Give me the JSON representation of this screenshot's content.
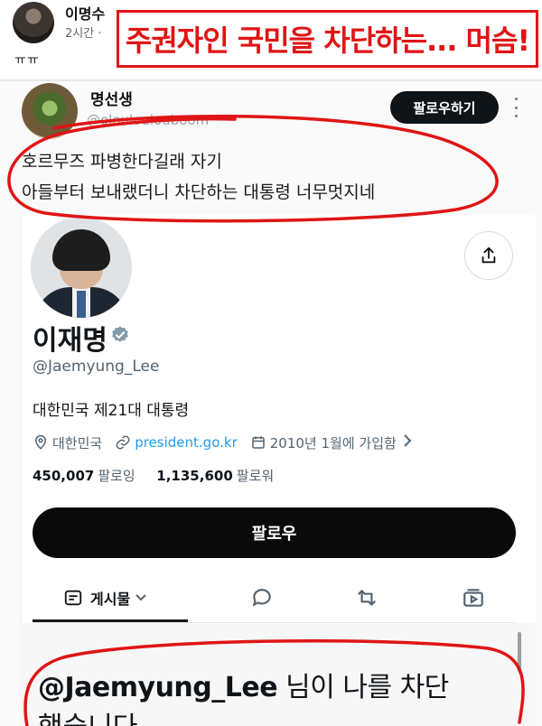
{
  "post": {
    "author": "이명수",
    "meta": "2시간 · ",
    "body": "ㅠㅠ",
    "banner_text": "주권자인 국민을 차단하는... 머슴!"
  },
  "tweet": {
    "account_name": "명선생",
    "account_handle": "@olouloulouboom",
    "follow_label": "팔로우하기",
    "line1": "호르무즈 파병한다길래 자기",
    "line2": "아들부터 보내랬더니 차단하는 대통령 너무멋지네"
  },
  "profile": {
    "name": "이재명",
    "handle": "@Jaemyung_Lee",
    "bio": "대한민국 제21대 대통령",
    "location": "대한민국",
    "website": "president.go.kr",
    "joined": "2010년 1월에 가입함",
    "following_count": "450,007",
    "following_label": "팔로잉",
    "followers_count": "1,135,600",
    "followers_label": "팔로워",
    "follow_button": "팔로우",
    "tab_posts": "게시물"
  },
  "blocked": {
    "handle": "@Jaemyung_Lee",
    "message_rest": " 님이 나를 차단",
    "line2": "했습니다"
  },
  "colors": {
    "annotation_red": "#e01515",
    "link_blue": "#1d9bf0",
    "muted_gray": "#536471",
    "button_black": "#0a0a0a"
  },
  "icons": [
    "verified-badge-icon",
    "location-pin-icon",
    "link-icon",
    "calendar-icon",
    "share-icon",
    "more-vertical-icon",
    "posts-tab-icon",
    "replies-icon",
    "retweet-icon",
    "media-icon",
    "chevron-down-icon",
    "chevron-right-icon"
  ]
}
